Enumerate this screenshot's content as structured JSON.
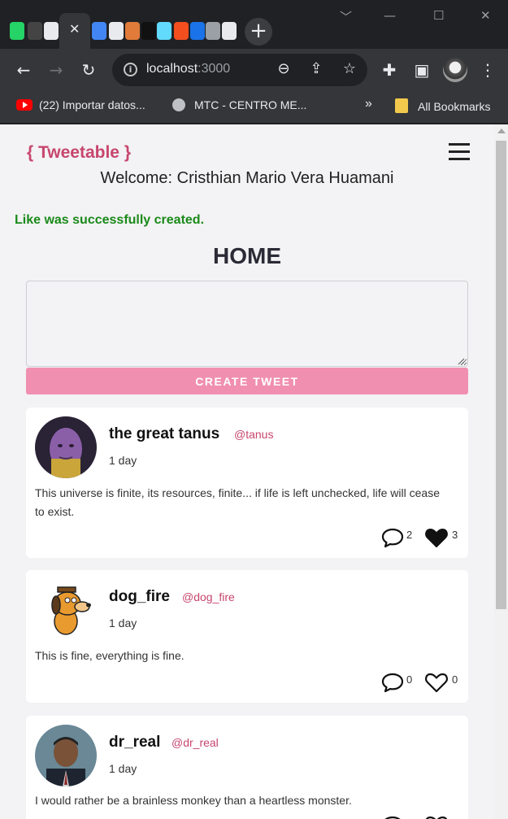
{
  "browser": {
    "active_tab_close": "✕",
    "new_tab": "+",
    "window_controls": [
      "﹀",
      "—",
      "☐",
      "✕"
    ],
    "url_host": "localhost",
    "url_port": ":3000",
    "bookmarks": [
      {
        "label": "(22) Importar datos...",
        "icon": "youtube-icon"
      },
      {
        "label": "MTC - CENTRO ME...",
        "icon": "globe-icon"
      }
    ],
    "bookmarks_overflow": "»",
    "all_bookmarks": "All Bookmarks"
  },
  "app": {
    "brand": "{ Tweetable }",
    "welcome": "Welcome: Cristhian Mario Vera Huamani",
    "flash": "Like was successfully created.",
    "title": "HOME",
    "composer_placeholder": "",
    "create_button": "Create tweet"
  },
  "colors": {
    "brand": "#c7466e",
    "button": "#f08fb0",
    "flash": "#1a8a1a",
    "page_bg": "#f3f2f4"
  },
  "tweets": [
    {
      "name": "the great tanus",
      "handle": "@tanus",
      "time": "1 day",
      "body": "This universe is finite, its resources, finite... if life is left unchecked, life will cease to exist.",
      "comments": "2",
      "likes": "3",
      "liked": true,
      "avatar": "thanos-avatar"
    },
    {
      "name": "dog_fire",
      "handle": "@dog_fire",
      "time": "1 day",
      "body": "This is fine, everything is fine.",
      "comments": "0",
      "likes": "0",
      "liked": false,
      "avatar": "dog-avatar"
    },
    {
      "name": "dr_real",
      "handle": "@dr_real",
      "time": "1 day",
      "body": "I would rather be a brainless monkey than a heartless monster.",
      "comments": "",
      "likes": "",
      "liked": false,
      "avatar": "scientist-avatar"
    }
  ]
}
